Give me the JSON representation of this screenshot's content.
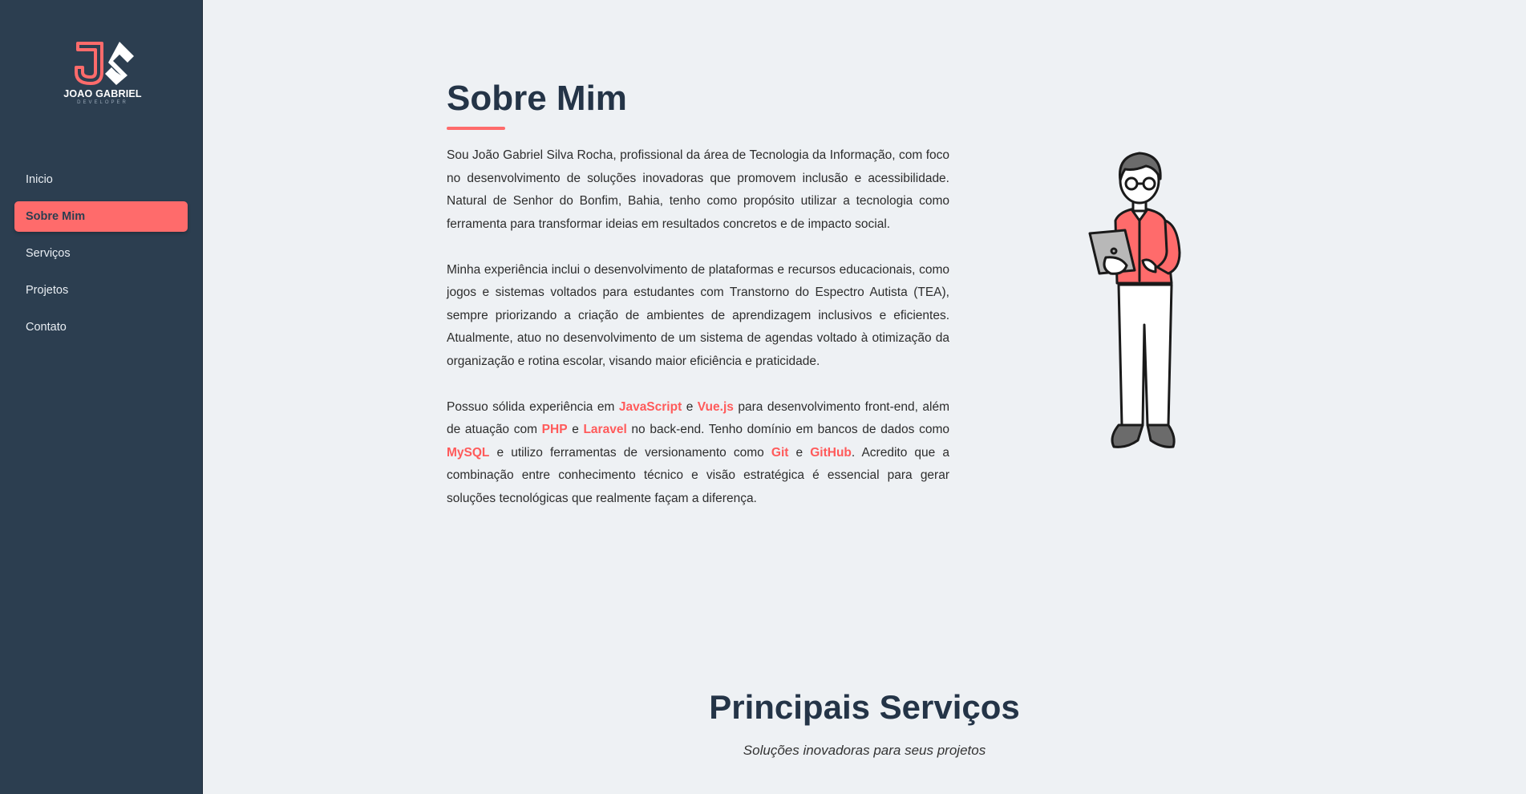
{
  "logo": {
    "name": "JOAO GABRIEL",
    "subtitle": "DEVELOPER"
  },
  "nav": {
    "items": [
      {
        "label": "Inicio",
        "active": false
      },
      {
        "label": "Sobre Mim",
        "active": true
      },
      {
        "label": "Serviços",
        "active": false
      },
      {
        "label": "Projetos",
        "active": false
      },
      {
        "label": "Contato",
        "active": false
      }
    ]
  },
  "about": {
    "title": "Sobre Mim",
    "p1": "Sou João Gabriel Silva Rocha, profissional da área de Tecnologia da Informação, com foco no desenvolvimento de soluções inovadoras que promovem inclusão e acessibilidade. Natural de Senhor do Bonfim, Bahia, tenho como propósito utilizar a tecnologia como ferramenta para transformar ideias em resultados concretos e de impacto social.",
    "p2": "Minha experiência inclui o desenvolvimento de plataformas e recursos educacionais, como jogos e sistemas voltados para estudantes com Transtorno do Espectro Autista (TEA), sempre priorizando a criação de ambientes de aprendizagem inclusivos e eficientes. Atualmente, atuo no desenvolvimento de um sistema de agendas voltado à otimização da organização e rotina escolar, visando maior eficiência e praticidade.",
    "p3": {
      "t1": "Possuo sólida experiência em ",
      "js": "JavaScript",
      "t2": " e ",
      "vue": "Vue.js",
      "t3": " para desenvolvimento front-end, além de atuação com ",
      "php": "PHP",
      "t4": " e ",
      "laravel": "Laravel",
      "t5": " no back-end. Tenho domínio em bancos de dados como ",
      "mysql": "MySQL",
      "t6": " e utilizo ferramentas de versionamento como ",
      "git": "Git",
      "t7": " e ",
      "github": "GitHub",
      "t8": ". Acredito que a combinação entre conhecimento técnico e visão estratégica é essencial para gerar soluções tecnológicas que realmente façam a diferença."
    }
  },
  "services": {
    "title": "Principais Serviços",
    "subtitle": "Soluções inovadoras para seus projetos"
  },
  "colors": {
    "sidebar": "#2c3e50",
    "accent": "#ff6b6b",
    "heading": "#243447",
    "background": "#eef1f4"
  },
  "icons": {
    "illustration": "developer-with-laptop-illustration"
  }
}
